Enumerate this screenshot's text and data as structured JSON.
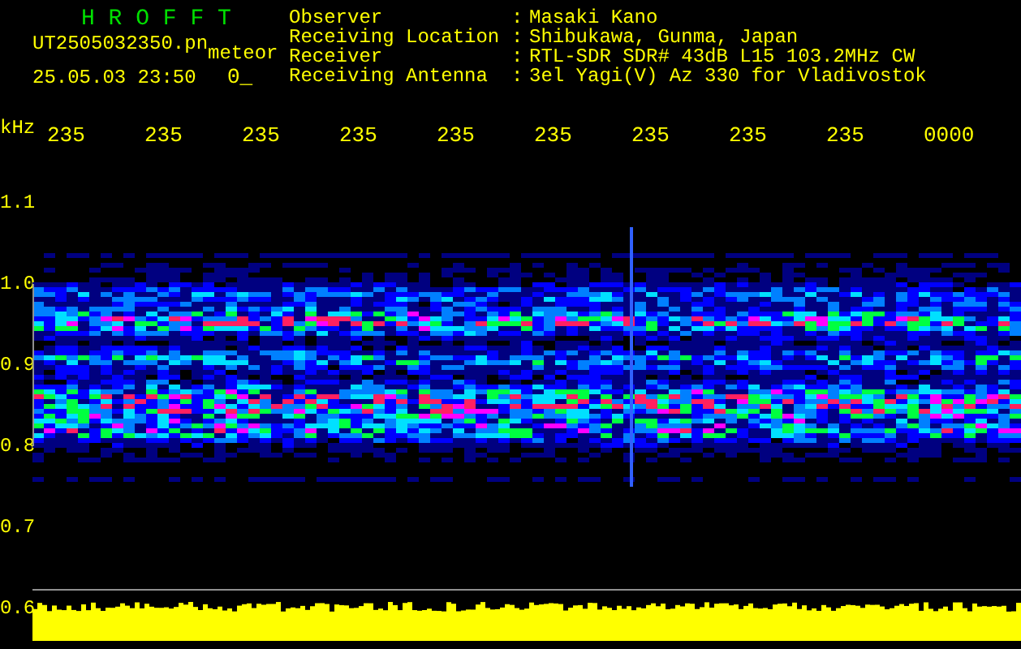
{
  "header": {
    "title": "H R O F F T",
    "file_name": "UT2505032350.pn",
    "mode": "meteor",
    "timestamp": "25.05.03 23:50",
    "count": "0_"
  },
  "station_info": [
    {
      "label": "Observer",
      "separator": ":",
      "value": "Masaki Kano"
    },
    {
      "label": "Receiving Location",
      "separator": ":",
      "value": "Shibukawa, Gunma, Japan"
    },
    {
      "label": "Receiver",
      "separator": ":",
      "value": "RTL-SDR SDR# 43dB L15 103.2MHz CW"
    },
    {
      "label": "Receiving Antenna",
      "separator": ":",
      "value": "3el Yagi(V) Az 330 for Vladivostok"
    }
  ],
  "time_axis": [
    "235",
    "235",
    "235",
    "235",
    "235",
    "235",
    "235",
    "235",
    "235",
    "0000"
  ],
  "frequency_axis": {
    "unit": "kHz",
    "labels": [
      "1.1",
      "1.0",
      "0.9",
      "0.8",
      "0.7",
      "0.6"
    ]
  }
}
